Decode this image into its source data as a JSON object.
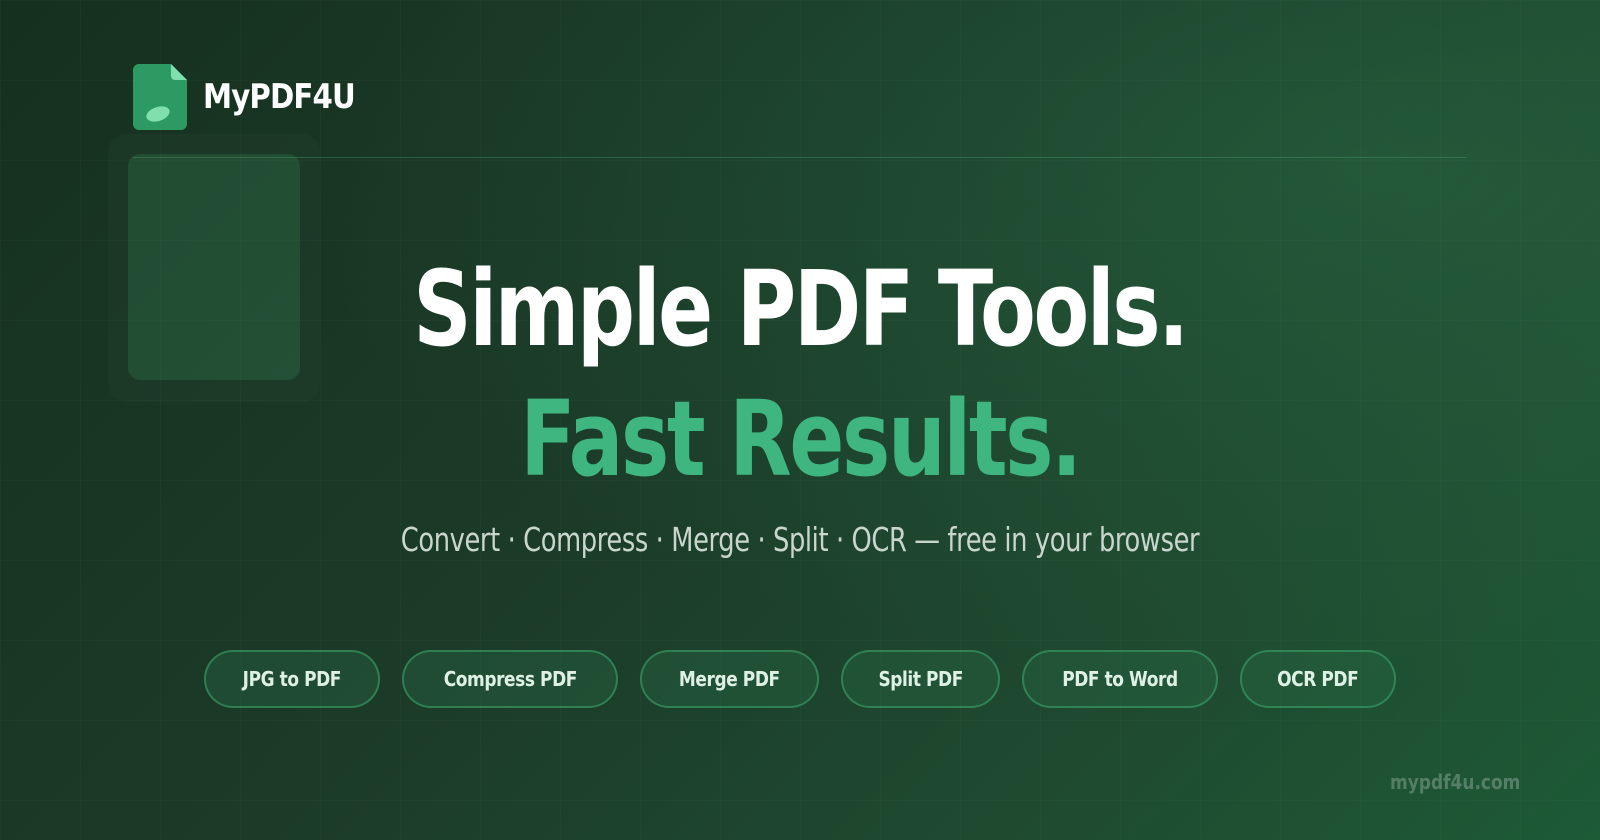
{
  "brand": {
    "name": "MyPDF4U",
    "logo_icon": "pdf-file-icon",
    "accent_color": "#3fb67f"
  },
  "hero": {
    "headline": "Simple PDF Tools.",
    "headline_accent": "Fast Results.",
    "tagline": "Convert · Compress · Merge · Split · OCR — free in your browser"
  },
  "tools": [
    {
      "label": "JPG to PDF"
    },
    {
      "label": "Compress PDF"
    },
    {
      "label": "Merge PDF"
    },
    {
      "label": "Split PDF"
    },
    {
      "label": "PDF to Word"
    },
    {
      "label": "OCR PDF"
    }
  ],
  "footer": {
    "url": "mypdf4u.com"
  }
}
